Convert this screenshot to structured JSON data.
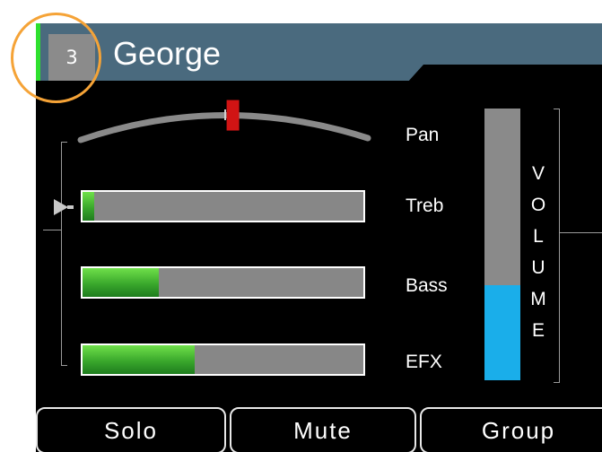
{
  "channel": {
    "number": "3",
    "name": "George"
  },
  "pan": {
    "label": "Pan",
    "value": 0.53
  },
  "sliders": [
    {
      "label": "Treb",
      "value": 0.04
    },
    {
      "label": "Bass",
      "value": 0.27
    },
    {
      "label": "EFX",
      "value": 0.4
    }
  ],
  "volume": {
    "letters": [
      "V",
      "O",
      "L",
      "U",
      "M",
      "E"
    ],
    "value": 0.35
  },
  "buttons": {
    "solo": "Solo",
    "mute": "Mute",
    "group": "Group"
  },
  "colors": {
    "header": "#4a6a7e",
    "fill_green": "#3aa82c",
    "volume_blue": "#1aaeea",
    "pan_marker": "#d11414",
    "highlight_ring": "#f5a337"
  }
}
